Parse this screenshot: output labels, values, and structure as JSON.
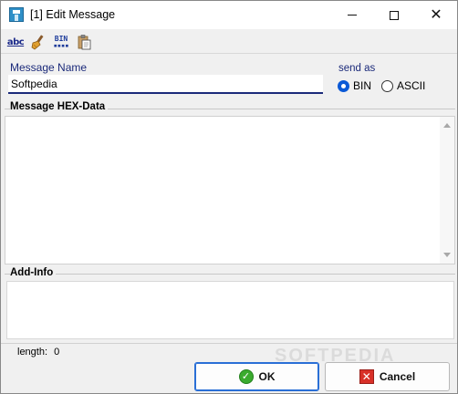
{
  "window": {
    "title": "[1] Edit Message"
  },
  "toolbar": {
    "abc_text": "abc",
    "bin_text": "BIN",
    "icons": [
      "spellcheck-icon",
      "brush-icon",
      "binary-icon",
      "paste-icon"
    ]
  },
  "message_name": {
    "label": "Message Name",
    "value": "Softpedia"
  },
  "send_as": {
    "label": "send as",
    "options": [
      {
        "label": "BIN",
        "checked": true
      },
      {
        "label": "ASCII",
        "checked": false
      }
    ]
  },
  "hex_data": {
    "title": "Message HEX-Data",
    "value": ""
  },
  "add_info": {
    "title": "Add-Info",
    "value": ""
  },
  "status": {
    "length_label": "length:",
    "length_value": "0"
  },
  "buttons": {
    "ok_label": "OK",
    "cancel_label": "Cancel"
  },
  "watermark": "SOFTPEDIA",
  "colors": {
    "accent": "#1b2a7a",
    "radio_checked": "#0a59d6",
    "ok_green": "#3aab2e",
    "cancel_red": "#d83028"
  }
}
